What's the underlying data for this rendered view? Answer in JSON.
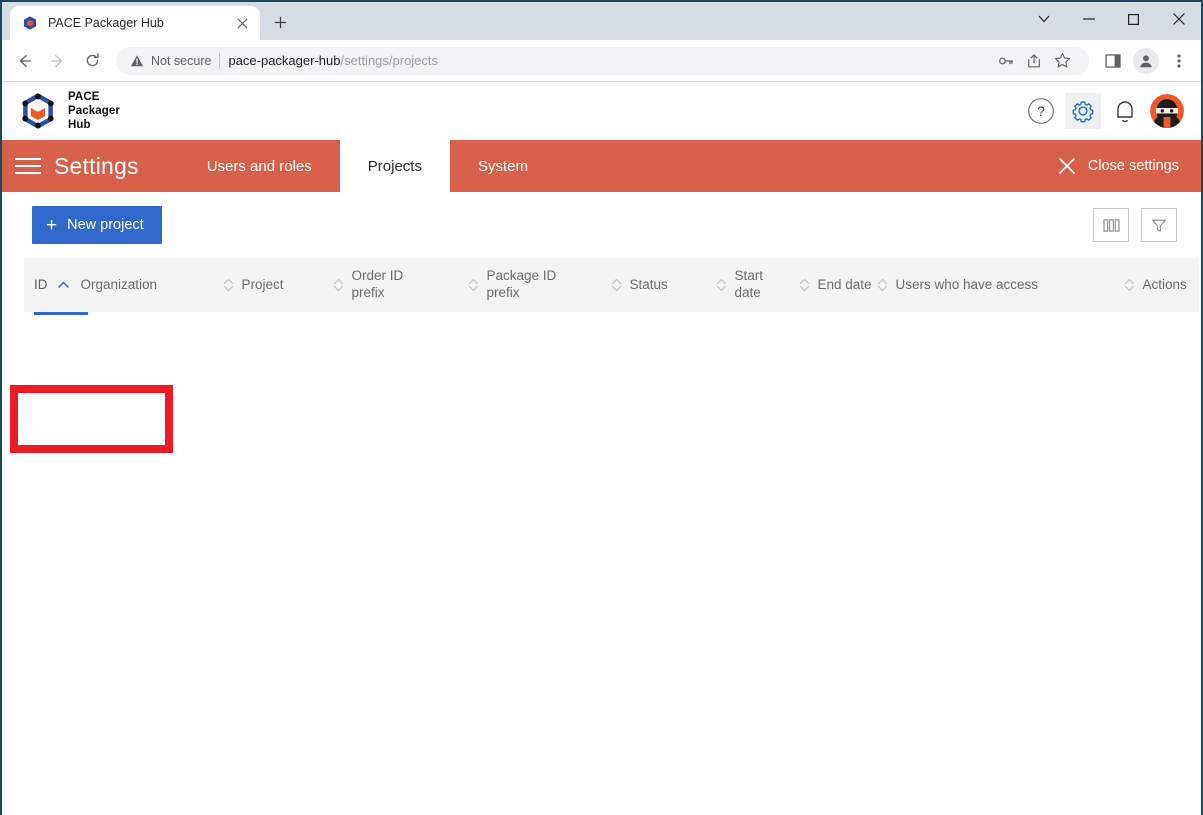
{
  "browser": {
    "tab": {
      "title": "PACE Packager Hub",
      "favicon_icon": "pace-cube-favicon",
      "close_icon": "close-icon"
    },
    "new_tab_icon": "plus-icon",
    "window_controls": [
      {
        "name": "tab-search-button",
        "icon": "chevron-down-icon"
      },
      {
        "name": "minimize-button",
        "icon": "minimize-icon"
      },
      {
        "name": "maximize-button",
        "icon": "maximize-icon"
      },
      {
        "name": "close-window-button",
        "icon": "close-icon"
      }
    ],
    "nav": {
      "back_icon": "arrow-left-icon",
      "forward_icon": "arrow-right-icon",
      "reload_icon": "reload-icon"
    },
    "omnibox": {
      "security_label": "Not secure",
      "security_icon": "warning-triangle-icon",
      "url_host": "pace-packager-hub",
      "url_path": "/settings/projects",
      "url_full": "pace-packager-hub/settings/projects",
      "icons": [
        "key-icon",
        "share-icon",
        "star-icon"
      ]
    },
    "toolbar_icons": [
      "side-panel-icon",
      "profile-icon",
      "more-menu-icon"
    ]
  },
  "app_header": {
    "logo_icon": "pace-cube-logo",
    "brand_line1": "PACE",
    "brand_line2": "Packager",
    "brand_line3": "Hub",
    "icons": [
      {
        "name": "help-icon",
        "label": "?"
      },
      {
        "name": "settings-gear-icon",
        "label": ""
      },
      {
        "name": "notifications-bell-icon",
        "label": ""
      },
      {
        "name": "user-avatar",
        "label": ""
      }
    ]
  },
  "settings_bar": {
    "menu_icon": "hamburger-menu-icon",
    "title": "Settings",
    "tabs": [
      {
        "label": "Users and roles",
        "active": false
      },
      {
        "label": "Projects",
        "active": true
      },
      {
        "label": "System",
        "active": false
      }
    ],
    "close_label": "Close settings",
    "close_icon": "close-icon",
    "accent_color": "#d7604a"
  },
  "toolbar": {
    "new_project_label": "New project",
    "new_project_icon": "plus-icon",
    "new_project_color": "#3068cc",
    "columns_icon": "columns-icon",
    "filter_icon": "filter-funnel-icon",
    "highlight_color": "#ee1b24"
  },
  "table": {
    "columns": [
      {
        "label": "ID",
        "sortable": true,
        "sorted": "asc",
        "sort_icon": "chevron-up-icon"
      },
      {
        "label": "Organization",
        "sortable": false,
        "sorted": "none",
        "sort_icon": ""
      },
      {
        "label": "Project",
        "sortable": true,
        "sorted": "none",
        "sort_icon": "sort-both-icon"
      },
      {
        "label": "Order ID\nprefix",
        "sortable": true,
        "sorted": "none",
        "sort_icon": "sort-both-icon"
      },
      {
        "label": "Package ID\nprefix",
        "sortable": true,
        "sorted": "none",
        "sort_icon": "sort-both-icon"
      },
      {
        "label": "Status",
        "sortable": true,
        "sorted": "none",
        "sort_icon": "sort-both-icon"
      },
      {
        "label": "Start\ndate",
        "sortable": true,
        "sorted": "none",
        "sort_icon": "sort-both-icon"
      },
      {
        "label": "End date",
        "sortable": true,
        "sorted": "none",
        "sort_icon": "sort-both-icon"
      },
      {
        "label": "Users who have access",
        "sortable": true,
        "sorted": "none",
        "sort_icon": "sort-both-icon"
      },
      {
        "label": "Actions",
        "sortable": true,
        "sorted": "none",
        "sort_icon": "sort-both-icon"
      }
    ],
    "rows": []
  }
}
